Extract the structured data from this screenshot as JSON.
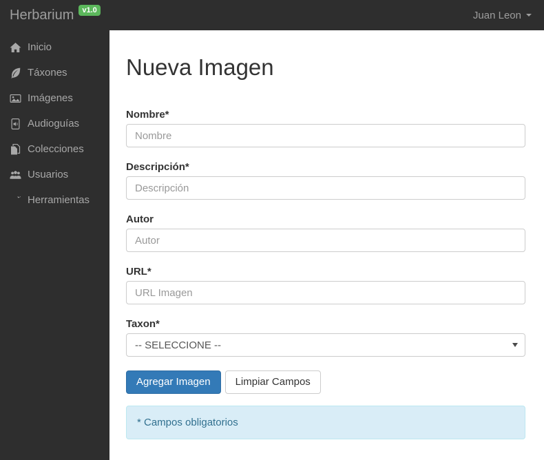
{
  "navbar": {
    "brand": "Herbarium",
    "version_badge": "v1.0",
    "user": "Juan Leon"
  },
  "sidebar": {
    "items": [
      {
        "label": "Inicio",
        "icon": "home-icon"
      },
      {
        "label": "Táxones",
        "icon": "leaf-icon"
      },
      {
        "label": "Imágenes",
        "icon": "image-icon"
      },
      {
        "label": "Audioguías",
        "icon": "audio-file-icon"
      },
      {
        "label": "Colecciones",
        "icon": "copy-icon"
      },
      {
        "label": "Usuarios",
        "icon": "users-icon"
      },
      {
        "label": "Herramientas",
        "icon": "wrench-icon"
      }
    ]
  },
  "main": {
    "title": "Nueva Imagen",
    "fields": [
      {
        "label": "Nombre*",
        "placeholder": "Nombre",
        "value": "",
        "type": "text"
      },
      {
        "label": "Descripción*",
        "placeholder": "Descripción",
        "value": "",
        "type": "text"
      },
      {
        "label": "Autor",
        "placeholder": "Autor",
        "value": "",
        "type": "text"
      },
      {
        "label": "URL*",
        "placeholder": "URL Imagen",
        "value": "",
        "type": "text"
      },
      {
        "label": "Taxon*",
        "value": "-- SELECCIONE --",
        "type": "select"
      }
    ],
    "buttons": {
      "submit": "Agregar Imagen",
      "reset": "Limpiar Campos"
    },
    "note": "* Campos obligatorios"
  },
  "colors": {
    "navbar_bg": "#2e2e2e",
    "badge_green": "#5cb85c",
    "primary_blue": "#337ab7",
    "alert_bg": "#d9edf7",
    "alert_border": "#bce8f1",
    "alert_text": "#31708f"
  }
}
